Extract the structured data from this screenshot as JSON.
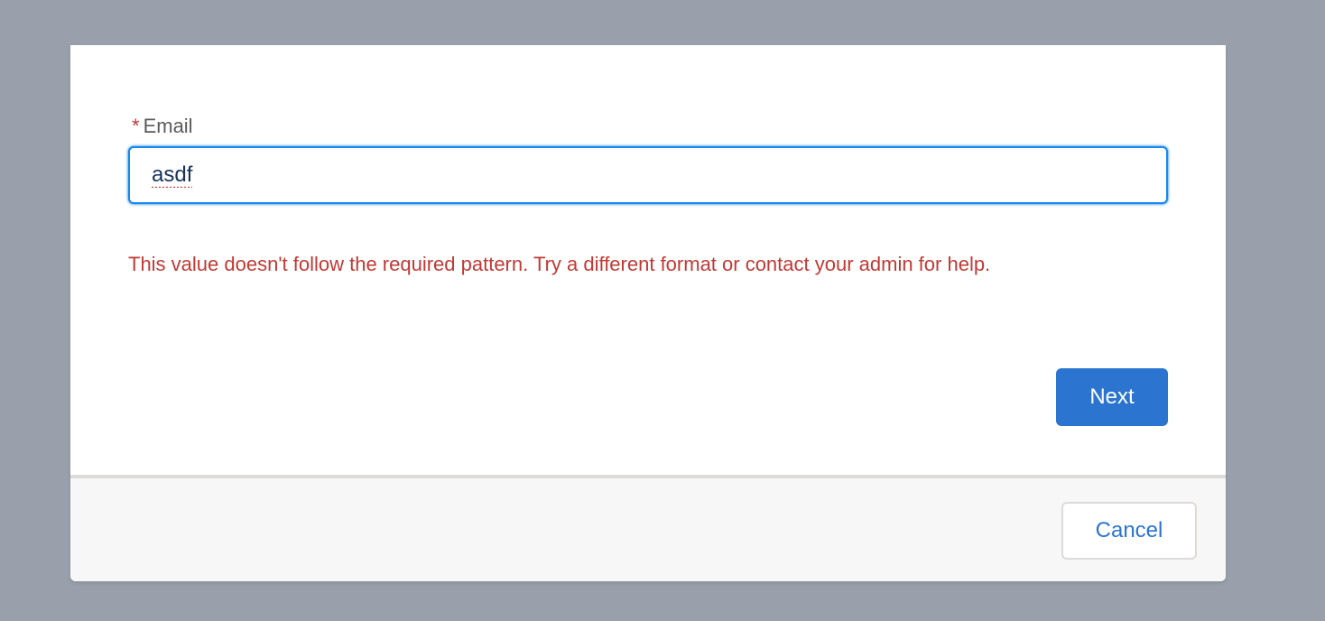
{
  "form": {
    "required_marker": "*",
    "email_label": "Email",
    "email_value": "asdf",
    "error_message": "This value doesn't follow the required pattern. Try a different format or contact your admin for help."
  },
  "actions": {
    "next_label": "Next",
    "cancel_label": "Cancel"
  },
  "colors": {
    "backdrop": "#9aa0ab",
    "accent": "#2b74cf",
    "error": "#c23934",
    "input_focus_border": "#1589ee",
    "footer_background": "#f7f7f7"
  }
}
